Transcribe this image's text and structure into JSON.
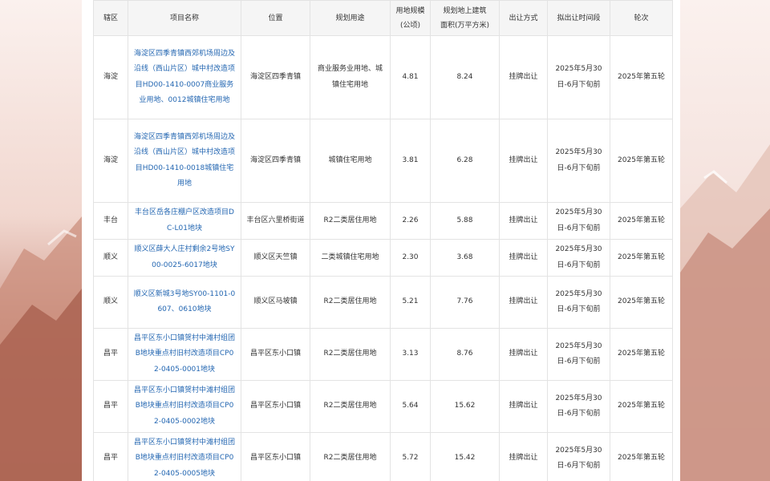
{
  "table": {
    "headers": [
      "辖区",
      "项目名称",
      "位置",
      "规划用途",
      "用地规模\n(公顷)",
      "规划地上建筑\n面积(万平方米)",
      "出让方式",
      "拟出让时间段",
      "轮次"
    ],
    "rows": [
      {
        "district": "海淀",
        "name": "海淀区四季青镇西郊机场周边及沿线（西山片区）城中村改造项目HD00-1410-0007商业服务业用地、0012城镇住宅用地",
        "location": "海淀区四季青镇",
        "use": "商业服务业用地、城镇住宅用地",
        "area": "4.81",
        "floor_area": "8.24",
        "method": "挂牌出让",
        "period": "2025年5月30日-6月下旬前",
        "round": "2025年第五轮"
      },
      {
        "district": "海淀",
        "name": "海淀区四季青镇西郊机场周边及沿线（西山片区）城中村改造项目HD00-1410-0018城镇住宅用地",
        "location": "海淀区四季青镇",
        "use": "城镇住宅用地",
        "area": "3.81",
        "floor_area": "6.28",
        "method": "挂牌出让",
        "period": "2025年5月30日-6月下旬前",
        "round": "2025年第五轮"
      },
      {
        "district": "丰台",
        "name": "丰台区岳各庄棚户区改造项目DC-L01地块",
        "location": "丰台区六里桥街道",
        "use": "R2二类居住用地",
        "area": "2.26",
        "floor_area": "5.88",
        "method": "挂牌出让",
        "period": "2025年5月30日-6月下旬前",
        "round": "2025年第五轮"
      },
      {
        "district": "顺义",
        "name": "顺义区薛大人庄村剩余2号地SY00-0025-6017地块",
        "location": "顺义区天竺镇",
        "use": "二类城镇住宅用地",
        "area": "2.30",
        "floor_area": "3.68",
        "method": "挂牌出让",
        "period": "2025年5月30日-6月下旬前",
        "round": "2025年第五轮"
      },
      {
        "district": "顺义",
        "name": "顺义区新城3号地SY00-1101-0607、0610地块",
        "location": "顺义区马坡镇",
        "use": "R2二类居住用地",
        "area": "5.21",
        "floor_area": "7.76",
        "method": "挂牌出让",
        "period": "2025年5月30日-6月下旬前",
        "round": "2025年第五轮"
      },
      {
        "district": "昌平",
        "name": "昌平区东小口镇贺村中滩村组团B地块重点村旧村改造项目CP02-0405-0001地块",
        "location": "昌平区东小口镇",
        "use": "R2二类居住用地",
        "area": "3.13",
        "floor_area": "8.76",
        "method": "挂牌出让",
        "period": "2025年5月30日-6月下旬前",
        "round": "2025年第五轮"
      },
      {
        "district": "昌平",
        "name": "昌平区东小口镇贺村中滩村组团B地块重点村旧村改造项目CP02-0405-0002地块",
        "location": "昌平区东小口镇",
        "use": "R2二类居住用地",
        "area": "5.64",
        "floor_area": "15.62",
        "method": "挂牌出让",
        "period": "2025年5月30日-6月下旬前",
        "round": "2025年第五轮"
      },
      {
        "district": "昌平",
        "name": "昌平区东小口镇贺村中滩村组团B地块重点村旧村改造项目CP02-0405-0005地块",
        "location": "昌平区东小口镇",
        "use": "R2二类居住用地",
        "area": "5.72",
        "floor_area": "15.42",
        "method": "挂牌出让",
        "period": "2025年5月30日-6月下旬前",
        "round": "2025年第五轮"
      }
    ]
  }
}
